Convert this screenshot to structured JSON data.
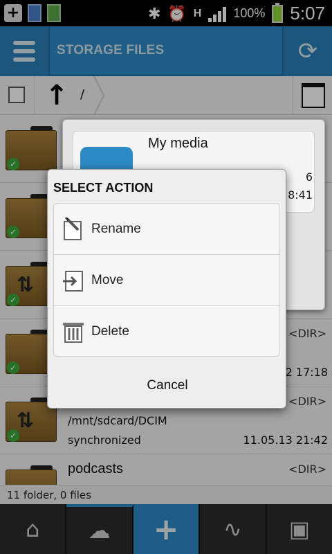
{
  "status_bar": {
    "battery_percent": "100%",
    "time": "5:07",
    "network_letter": "H"
  },
  "header": {
    "title": "STORAGE FILES"
  },
  "path_bar": {
    "path": "/"
  },
  "rows": [
    {
      "name": "",
      "path": "",
      "status": "",
      "date": "",
      "dir": ""
    },
    {
      "name": "",
      "path": "",
      "status": "",
      "date": "",
      "dir": ""
    },
    {
      "name": "",
      "path": "",
      "status": "",
      "date": "",
      "dir": ""
    },
    {
      "name": "",
      "path": "",
      "status": "",
      "date": "2 17:18",
      "dir": "<DIR>"
    },
    {
      "name": "",
      "path": "/mnt/sdcard/DCIM",
      "status": "synchronized",
      "date": "11.05.13 21:42",
      "dir": "<DIR>"
    },
    {
      "name": "podcasts",
      "path": "",
      "status": "",
      "date": "",
      "dir": "<DIR>"
    }
  ],
  "background_popup": {
    "title": "My media",
    "time_fragment": "8:41",
    "side_fragment": "6"
  },
  "dialog": {
    "title": "SELECT ACTION",
    "actions": [
      {
        "label": "Rename",
        "icon": "rename-icon"
      },
      {
        "label": "Move",
        "icon": "move-icon"
      },
      {
        "label": "Delete",
        "icon": "trash-icon"
      }
    ],
    "cancel_label": "Cancel"
  },
  "footer": {
    "summary": "11 folder, 0 files"
  },
  "colors": {
    "accent": "#2d89c4",
    "header_dark": "#1c6ea2",
    "sync_ok": "#3aa83a",
    "battery": "#8fd93a"
  }
}
